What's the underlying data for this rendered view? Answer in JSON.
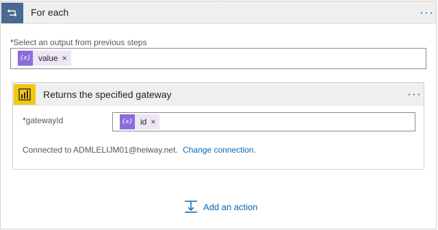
{
  "foreach": {
    "title": "For each",
    "more_label": "···"
  },
  "output_field": {
    "label": "Select an output from previous steps",
    "required_mark": "*",
    "token": {
      "text": "value",
      "icon": "{x}",
      "remove": "×"
    }
  },
  "action": {
    "title": "Returns the specified gateway",
    "more_label": "···",
    "field": {
      "label": "gatewayId",
      "required_mark": "*",
      "token": {
        "text": "id",
        "icon": "{x}",
        "remove": "×"
      }
    },
    "connection_text": "Connected to ADMLELIJM01@heiway.net.",
    "change_link": "Change connection."
  },
  "add_action_label": "Add an action",
  "colors": {
    "loop_icon_bg": "#486991",
    "powerbi_icon_bg": "#f2c811",
    "token_bg": "#ece6f5",
    "token_icon_bg": "#8c6cd9",
    "link": "#0067b8"
  }
}
